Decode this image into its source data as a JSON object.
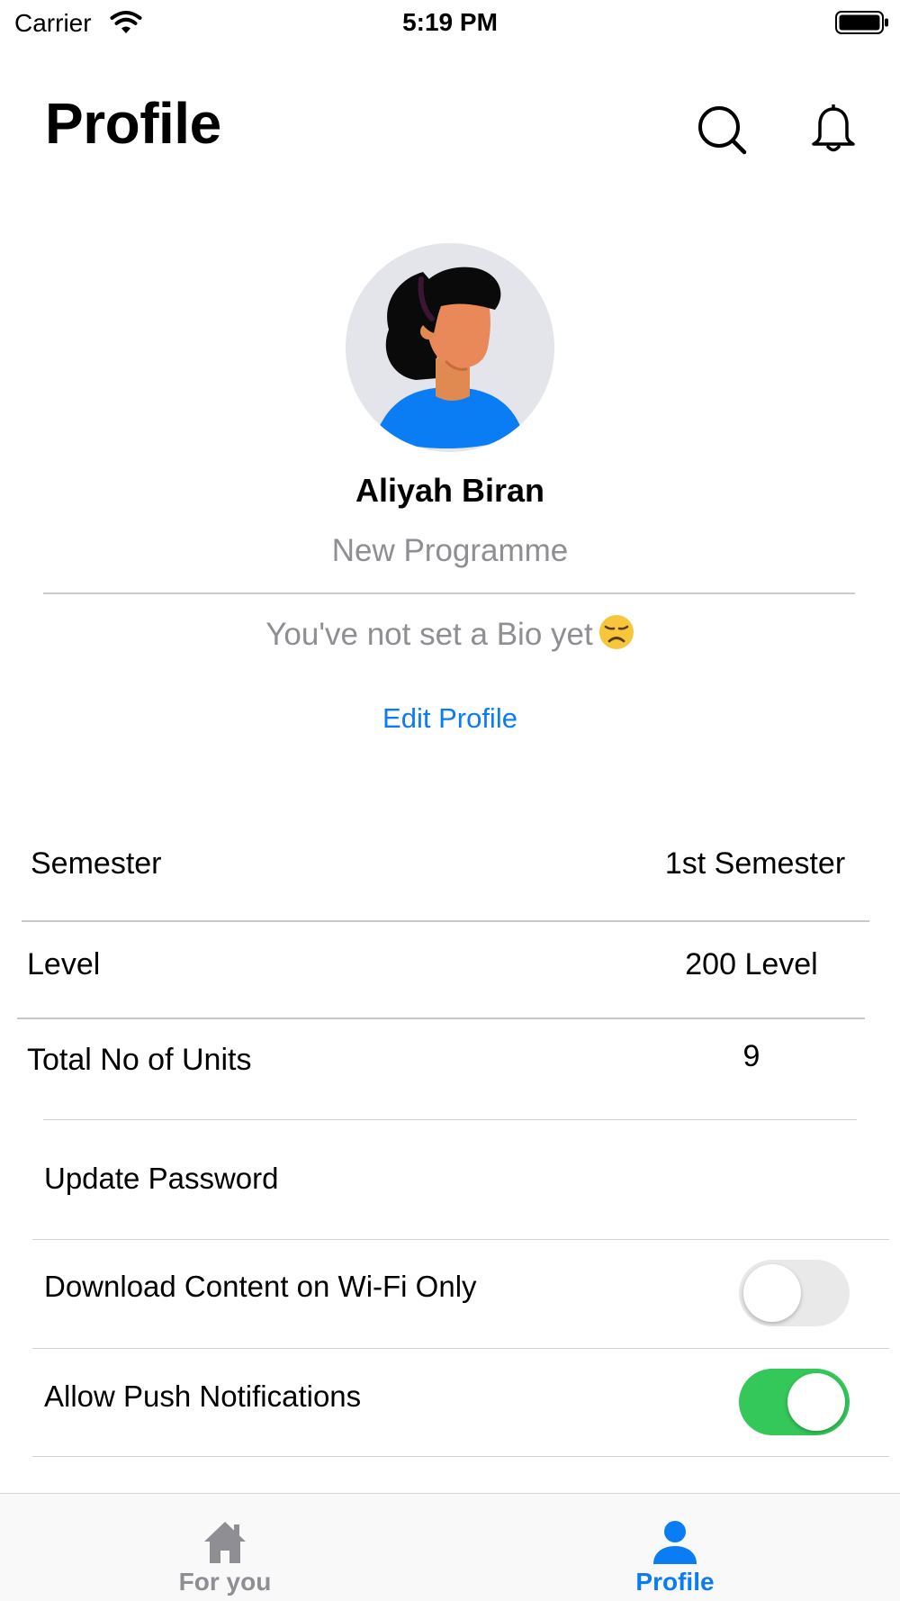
{
  "status_bar": {
    "carrier": "Carrier",
    "time": "5:19 PM",
    "icons": [
      "wifi-icon",
      "battery-icon"
    ]
  },
  "header": {
    "title": "Profile",
    "icons": [
      "search-icon",
      "bell-icon"
    ]
  },
  "profile": {
    "avatar": "avatar-illustration",
    "name": "Aliyah Biran",
    "programme": "New Programme",
    "bio": "You've not set a Bio yet",
    "bio_emoji": "disappointed-face-emoji",
    "edit_label": "Edit Profile"
  },
  "info": [
    {
      "label": "Semester",
      "value": "1st Semester"
    },
    {
      "label": "Level",
      "value": "200 Level"
    },
    {
      "label": "Total No of Units",
      "value": "9"
    }
  ],
  "settings": {
    "update_password": "Update Password",
    "wifi_only": {
      "label": "Download Content on Wi-Fi Only",
      "enabled": false
    },
    "push": {
      "label": "Allow Push Notifications",
      "enabled": true
    }
  },
  "tabs": [
    {
      "label": "For you",
      "icon": "home-icon",
      "active": false
    },
    {
      "label": "Profile",
      "icon": "person-icon",
      "active": true
    }
  ],
  "colors": {
    "accent": "#0a7cf4",
    "toggle_on": "#34c759",
    "secondary_text": "#8e8e93"
  }
}
